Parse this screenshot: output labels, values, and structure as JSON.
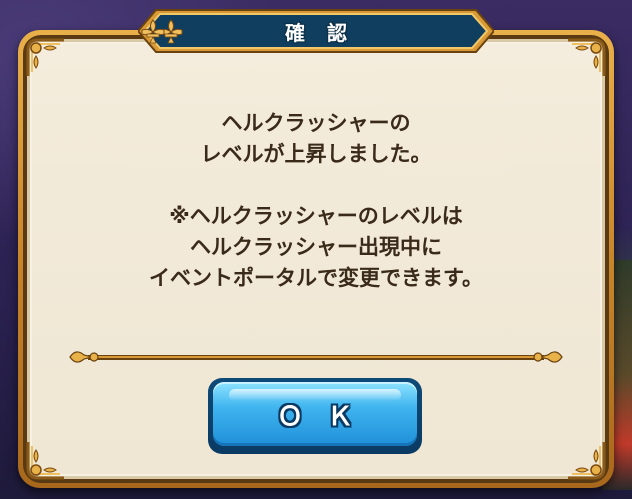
{
  "dialog": {
    "title": "確認",
    "message_lines": [
      "ヘルクラッシャーの",
      "レベルが上昇しました。",
      "",
      "※ヘルクラッシャーのレベルは",
      "ヘルクラッシャー出現中に",
      "イベントポータルで変更できます。"
    ],
    "ok_label": "ＯＫ"
  },
  "colors": {
    "frame_gold": "#c8862a",
    "panel_cream": "#f4ecdc",
    "title_navy": "#0f3e5e",
    "button_blue": "#3fb4ef",
    "text_brown": "#3a2a1a"
  },
  "icons": {
    "corner": "fleur-de-lis-corner-icon",
    "banner_end": "fleur-de-lis-icon",
    "divider_end": "fleur-de-lis-icon"
  }
}
